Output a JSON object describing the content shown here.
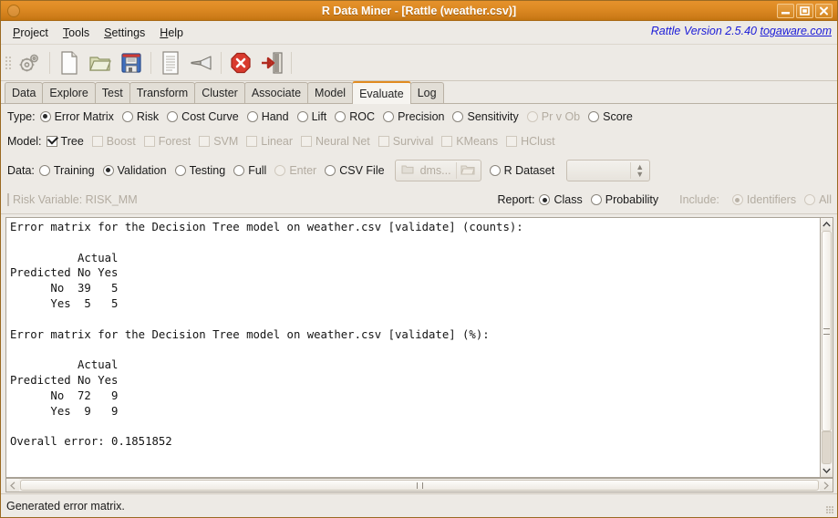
{
  "window": {
    "title": "R Data Miner - [Rattle (weather.csv)]",
    "icon": "app-circle-icon",
    "buttons": [
      {
        "name": "minimize-button",
        "glyph": "minimize"
      },
      {
        "name": "maximize-button",
        "glyph": "maximize"
      },
      {
        "name": "close-button",
        "glyph": "close"
      }
    ]
  },
  "menubar": {
    "items": [
      {
        "label": "Project",
        "mnemonic": "P"
      },
      {
        "label": "Tools",
        "mnemonic": "T"
      },
      {
        "label": "Settings",
        "mnemonic": "S"
      },
      {
        "label": "Help",
        "mnemonic": "H"
      }
    ],
    "version_text": "Rattle Version 2.5.40 ",
    "version_link": "togaware.com"
  },
  "toolbar": {
    "items": [
      {
        "name": "execute-button",
        "icon": "gears-icon",
        "label": "Execute"
      },
      {
        "name": "new-button",
        "icon": "new-file-icon",
        "label": "New"
      },
      {
        "name": "open-button",
        "icon": "open-folder-icon",
        "label": "Open"
      },
      {
        "name": "save-button",
        "icon": "floppy-save-icon",
        "label": "Save"
      },
      {
        "name": "report-button",
        "icon": "report-document-icon",
        "label": "Report"
      },
      {
        "name": "export-button",
        "icon": "export-icon",
        "label": "Export"
      },
      {
        "name": "stop-button",
        "icon": "stop-error-icon",
        "label": "Stop"
      },
      {
        "name": "quit-button",
        "icon": "exit-door-icon",
        "label": "Quit"
      }
    ]
  },
  "tabs": [
    {
      "label": "Data",
      "active": false
    },
    {
      "label": "Explore",
      "active": false
    },
    {
      "label": "Test",
      "active": false
    },
    {
      "label": "Transform",
      "active": false
    },
    {
      "label": "Cluster",
      "active": false
    },
    {
      "label": "Associate",
      "active": false
    },
    {
      "label": "Model",
      "active": false
    },
    {
      "label": "Evaluate",
      "active": true
    },
    {
      "label": "Log",
      "active": false
    }
  ],
  "type_row": {
    "label": "Type:",
    "options": [
      {
        "label": "Error Matrix",
        "selected": true,
        "disabled": false
      },
      {
        "label": "Risk",
        "selected": false,
        "disabled": false
      },
      {
        "label": "Cost Curve",
        "selected": false,
        "disabled": false
      },
      {
        "label": "Hand",
        "selected": false,
        "disabled": false
      },
      {
        "label": "Lift",
        "selected": false,
        "disabled": false
      },
      {
        "label": "ROC",
        "selected": false,
        "disabled": false
      },
      {
        "label": "Precision",
        "selected": false,
        "disabled": false
      },
      {
        "label": "Sensitivity",
        "selected": false,
        "disabled": false
      },
      {
        "label": "Pr v Ob",
        "selected": false,
        "disabled": true
      },
      {
        "label": "Score",
        "selected": false,
        "disabled": false
      }
    ]
  },
  "model_row": {
    "label": "Model:",
    "options": [
      {
        "label": "Tree",
        "checked": true,
        "disabled": false
      },
      {
        "label": "Boost",
        "checked": false,
        "disabled": true
      },
      {
        "label": "Forest",
        "checked": false,
        "disabled": true
      },
      {
        "label": "SVM",
        "checked": false,
        "disabled": true
      },
      {
        "label": "Linear",
        "checked": false,
        "disabled": true
      },
      {
        "label": "Neural Net",
        "checked": false,
        "disabled": true
      },
      {
        "label": "Survival",
        "checked": false,
        "disabled": true
      },
      {
        "label": "KMeans",
        "checked": false,
        "disabled": true
      },
      {
        "label": "HClust",
        "checked": false,
        "disabled": true
      }
    ]
  },
  "data_row": {
    "label": "Data:",
    "options": [
      {
        "label": "Training",
        "selected": false,
        "disabled": false
      },
      {
        "label": "Validation",
        "selected": true,
        "disabled": false
      },
      {
        "label": "Testing",
        "selected": false,
        "disabled": false
      },
      {
        "label": "Full",
        "selected": false,
        "disabled": false
      },
      {
        "label": "Enter",
        "selected": false,
        "disabled": true
      },
      {
        "label": "CSV File",
        "selected": false,
        "disabled": false
      }
    ],
    "csv_file_button": {
      "filename": "dms...",
      "disabled": true
    },
    "r_dataset": {
      "label": "R Dataset",
      "selected": false,
      "value": ""
    }
  },
  "report_row": {
    "risk_variable": "Risk Variable: RISK_MM",
    "report_label": "Report:",
    "report_options": [
      {
        "label": "Class",
        "selected": true,
        "disabled": false
      },
      {
        "label": "Probability",
        "selected": false,
        "disabled": false
      }
    ],
    "include_label": "Include:",
    "include_options": [
      {
        "label": "Identifiers",
        "selected": true,
        "disabled": true
      },
      {
        "label": "All",
        "selected": false,
        "disabled": true
      }
    ]
  },
  "output": {
    "text": "Error matrix for the Decision Tree model on weather.csv [validate] (counts):\n\n          Actual\nPredicted No Yes\n      No  39   5\n      Yes  5   5\n\nError matrix for the Decision Tree model on weather.csv [validate] (%):\n\n          Actual\nPredicted No Yes\n      No  72   9\n      Yes  9   9\n\nOverall error: 0.1851852\n"
  },
  "statusbar": {
    "message": "Generated error matrix."
  },
  "colors": {
    "titlebar_accent": "#d9861f",
    "active_tab_accent": "#e08b20",
    "window_bg": "#edeae5",
    "text_area_bg": "#ffffff",
    "link": "#1b1bd8"
  }
}
